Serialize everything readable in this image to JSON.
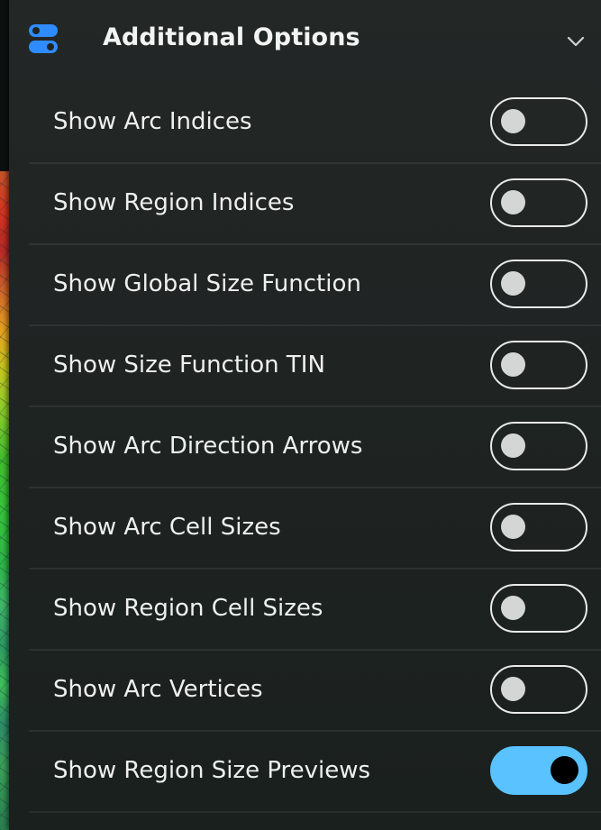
{
  "header": {
    "title": "Additional Options",
    "icon": "toggle-settings-icon",
    "chevron_icon": "chevron-down-icon",
    "accent_color": "#2f8cff"
  },
  "options": [
    {
      "label": "Show Arc Indices",
      "on": false
    },
    {
      "label": "Show Region Indices",
      "on": false
    },
    {
      "label": "Show Global Size Function",
      "on": false
    },
    {
      "label": "Show Size Function TIN",
      "on": false
    },
    {
      "label": "Show Arc Direction Arrows",
      "on": false
    },
    {
      "label": "Show Arc Cell Sizes",
      "on": false
    },
    {
      "label": "Show Region Cell Sizes",
      "on": false
    },
    {
      "label": "Show Arc Vertices",
      "on": false
    },
    {
      "label": "Show Region Size Previews",
      "on": true
    }
  ],
  "colors": {
    "toggle_on": "#59c2ff",
    "toggle_off_border": "#e8eaea",
    "panel_bg": "#1f2423"
  }
}
